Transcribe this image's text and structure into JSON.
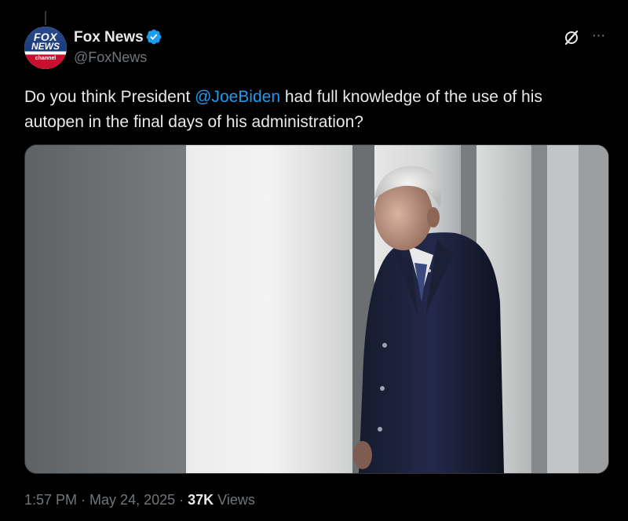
{
  "author": {
    "name": "Fox News",
    "handle": "@FoxNews",
    "verified": true,
    "avatar_logo": {
      "line1": "FOX",
      "line2": "NEWS",
      "line3": "channel"
    }
  },
  "tweet": {
    "text_before": "Do you think President ",
    "mention": "@JoeBiden",
    "text_after": " had full knowledge of the use of his autopen in the final days of his administration?"
  },
  "meta": {
    "time": "1:57 PM",
    "separator": " · ",
    "date": "May 24, 2025",
    "views_count": "37K",
    "views_label": " Views"
  },
  "icons": {
    "verified": "verified-badge-icon",
    "grok": "grok-icon",
    "more": "more-icon"
  },
  "colors": {
    "background": "#000000",
    "text": "#e7e9ea",
    "secondary": "#71767b",
    "accent": "#1d9bf0"
  }
}
